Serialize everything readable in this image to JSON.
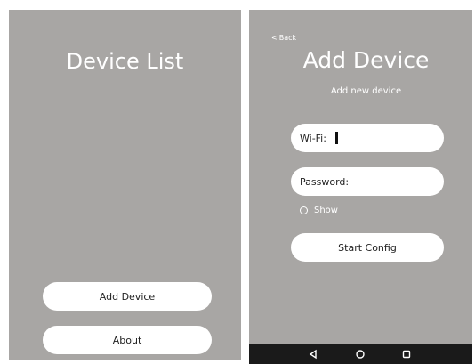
{
  "device_list_screen": {
    "title": "Device List",
    "add_device_label": "Add Device",
    "about_label": "About"
  },
  "add_device_screen": {
    "back_label": "Back",
    "title": "Add Device",
    "subtitle": "Add new device",
    "wifi_label": "Wi-Fi:",
    "password_label": "Password:",
    "show_label": "Show",
    "start_config_label": "Start Config"
  },
  "nav_bar": {
    "icons": [
      "nav-back-icon",
      "nav-home-icon",
      "nav-recent-apps-icon"
    ]
  },
  "colors": {
    "screen_background": "#a8a6a4",
    "button_background": "#ffffff",
    "nav_bar_background": "#1a1a1a"
  }
}
